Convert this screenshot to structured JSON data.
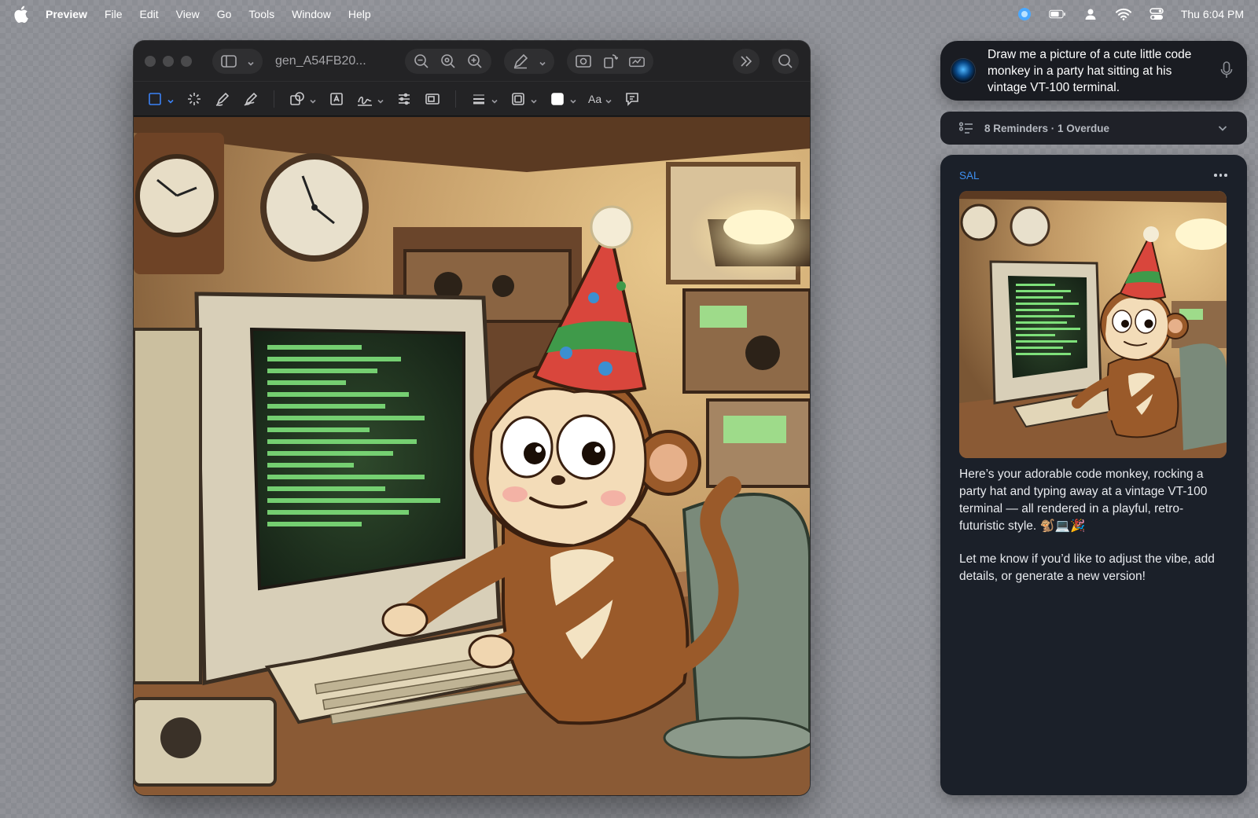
{
  "menubar": {
    "app_name": "Preview",
    "items": [
      "File",
      "Edit",
      "View",
      "Go",
      "Tools",
      "Window",
      "Help"
    ],
    "clock": "Thu 6:04 PM"
  },
  "window": {
    "doc_title": "gen_A54FB20...",
    "annotation_text_label": "Aa"
  },
  "assistant": {
    "prompt": "Draw me a picture of a cute little code monkey in a party hat sitting at his vintage VT-100 terminal.",
    "reminders": "8 Reminders · 1 Overdue",
    "sender": "SAL",
    "reply_paragraph_1": "Here’s your adorable code monkey, rocking a party hat and typing away at a vintage VT-100 terminal — all rendered in a playful, retro-futuristic style. 🐒💻🎉",
    "reply_paragraph_2": "Let me know if you’d like to adjust the vibe, add details, or generate a new version!"
  },
  "colors": {
    "accent_blue": "#3e8ff0",
    "panel_bg": "#1b2029",
    "window_bg": "#1e1e20"
  }
}
